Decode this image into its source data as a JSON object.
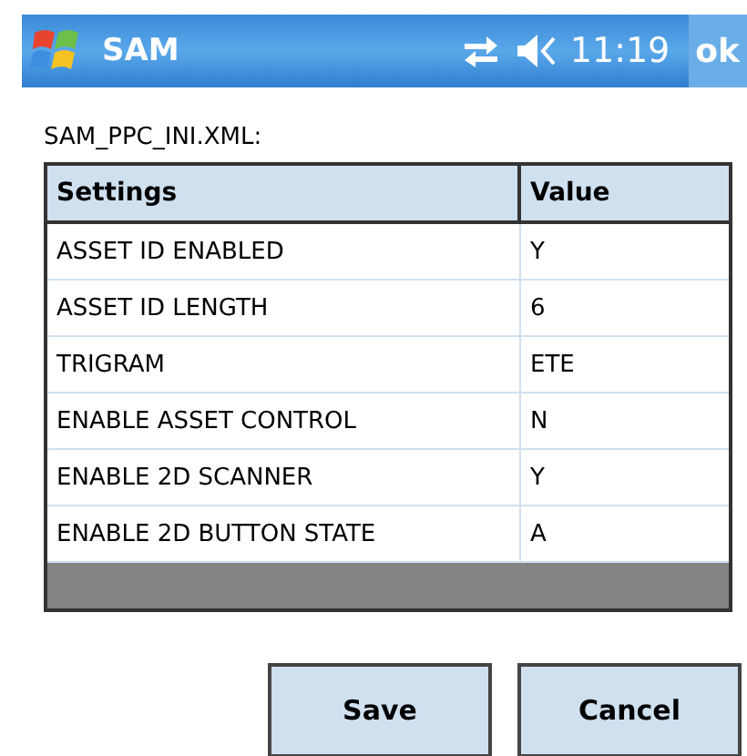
{
  "title_bar": {
    "title": "SAM",
    "time": "11:19",
    "ok": "ok"
  },
  "file_label": "SAM_PPC_INI.XML:",
  "table": {
    "columns": [
      "Settings",
      "Value"
    ],
    "rows": [
      {
        "setting": "ASSET ID ENABLED",
        "value": "Y"
      },
      {
        "setting": "ASSET ID LENGTH",
        "value": "6"
      },
      {
        "setting": "TRIGRAM",
        "value": "ETE"
      },
      {
        "setting": "ENABLE ASSET CONTROL",
        "value": "N"
      },
      {
        "setting": "ENABLE 2D SCANNER",
        "value": "Y"
      },
      {
        "setting": "ENABLE 2D BUTTON STATE",
        "value": "A"
      }
    ]
  },
  "buttons": [
    "Save",
    "Cancel"
  ]
}
